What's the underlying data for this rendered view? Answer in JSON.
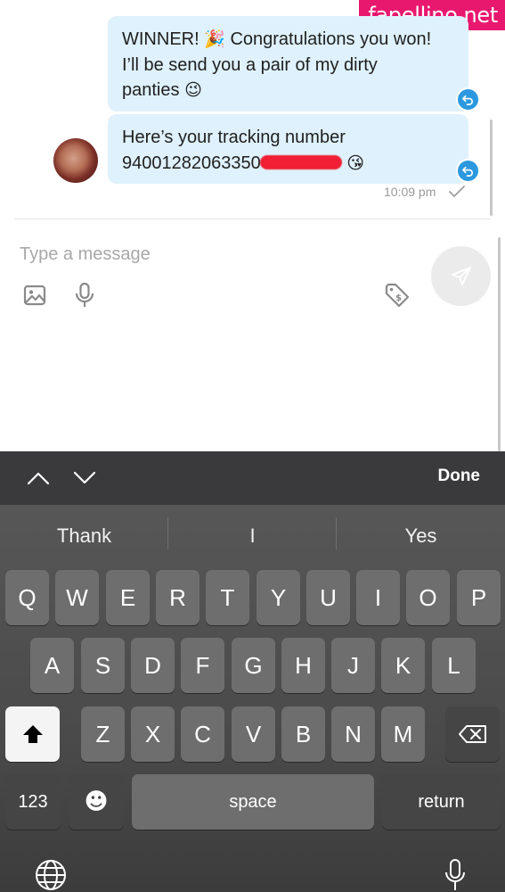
{
  "watermark": "fapellino.net",
  "chat": {
    "messages": [
      {
        "line1_before_emoji": "WINNER! ",
        "emoji1": "🎉",
        "line1_after_emoji": " Congratulations you won!",
        "line2": "I’ll be send you a pair of my dirty",
        "line3": "panties ",
        "emoji2": "😉"
      },
      {
        "line1": "Here’s your tracking number",
        "tracking_visible": "94001282063350",
        "emoji": "😘"
      }
    ],
    "timestamp": "10:09 pm",
    "status_icon": "read-check-icon"
  },
  "composer": {
    "placeholder": "Type a message"
  },
  "keyboard": {
    "done_label": "Done",
    "suggestions": [
      "Thank",
      "I",
      "Yes"
    ],
    "row1": [
      "Q",
      "W",
      "E",
      "R",
      "T",
      "Y",
      "U",
      "I",
      "O",
      "P"
    ],
    "row2": [
      "A",
      "S",
      "D",
      "F",
      "G",
      "H",
      "J",
      "K",
      "L"
    ],
    "row3": [
      "Z",
      "X",
      "C",
      "V",
      "B",
      "N",
      "M"
    ],
    "numbers_label": "123",
    "space_label": "space",
    "return_label": "return",
    "emoji_key": "☻"
  },
  "colors": {
    "bubble": "#dff1fc",
    "accent": "#2b98df",
    "watermark_bg": "#e9186f",
    "keyboard_bg": "#4a4a4a"
  }
}
